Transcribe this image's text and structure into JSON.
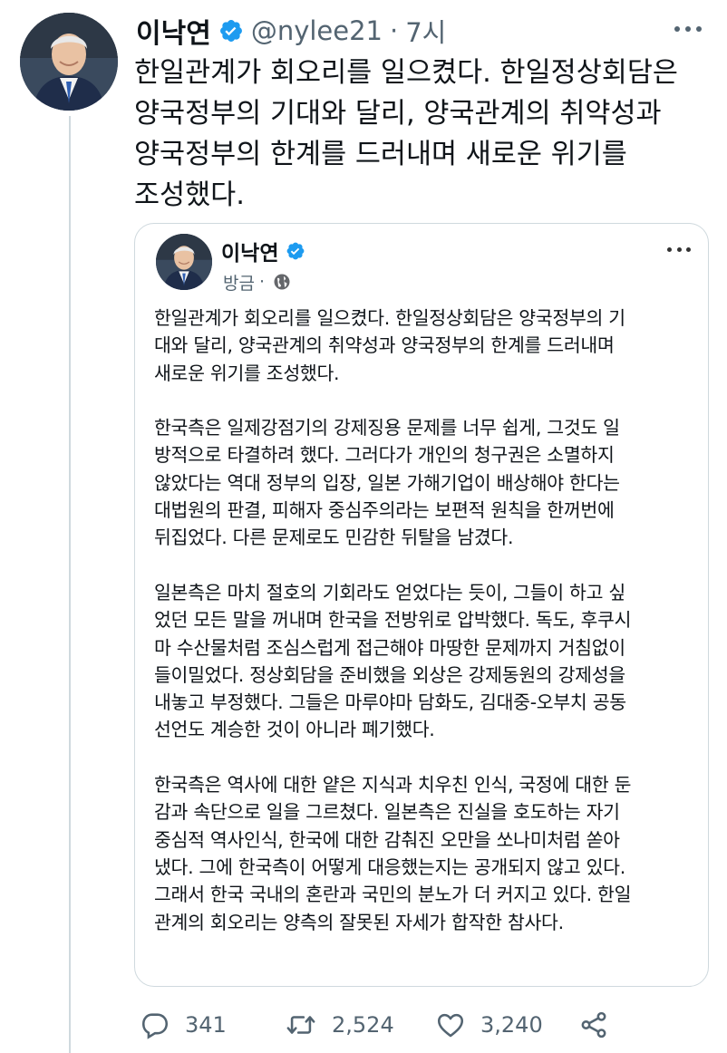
{
  "tweet": {
    "author_name": "이낙연",
    "handle": "@nylee21",
    "separator": "·",
    "time": "7시",
    "text": "한일관계가 회오리를 일으켰다. 한일정상회담은\n양국정부의 기대와 달리, 양국관계의 취약성과\n양국정부의 한계를 드러내며 새로운 위기를\n조성했다."
  },
  "quote": {
    "author_name": "이낙연",
    "time": "방금",
    "separator": "·",
    "body": "한일관계가 회오리를 일으켰다. 한일정상회담은 양국정부의 기\n대와 달리, 양국관계의 취약성과 양국정부의 한계를 드러내며\n새로운 위기를 조성했다.\n\n한국측은 일제강점기의 강제징용 문제를 너무 쉽게, 그것도 일\n방적으로 타결하려 했다. 그러다가 개인의 청구권은 소멸하지\n않았다는 역대 정부의 입장, 일본 가해기업이 배상해야 한다는\n대법원의 판결, 피해자 중심주의라는 보편적 원칙을 한꺼번에\n뒤집었다. 다른 문제로도 민감한 뒤탈을 남겼다.\n\n일본측은 마치 절호의 기회라도 얻었다는 듯이, 그들이 하고 싶\n었던 모든 말을 꺼내며 한국을 전방위로 압박했다. 독도, 후쿠시\n마 수산물처럼 조심스럽게 접근해야 마땅한 문제까지 거침없이\n들이밀었다. 정상회담을 준비했을 외상은 강제동원의 강제성을\n내놓고 부정했다. 그들은 마루야마 담화도, 김대중-오부치 공동\n선언도 계승한 것이 아니라 폐기했다.\n\n한국측은 역사에 대한 얕은 지식과 치우친 인식, 국정에 대한 둔\n감과 속단으로 일을 그르쳤다. 일본측은 진실을 호도하는 자기\n중심적 역사인식, 한국에 대한 감춰진 오만을 쏘나미처럼 쏟아\n냈다. 그에 한국측이 어떻게 대응했는지는 공개되지 않고 있다.\n그래서 한국 국내의 혼란과 국민의 분노가 더 커지고 있다. 한일\n관계의 회오리는 양측의 잘못된 자세가 합작한 참사다."
  },
  "actions": {
    "replies": "341",
    "retweets": "2,524",
    "likes": "3,240"
  },
  "icons": {
    "verified": "verified-badge-icon",
    "globe": "globe-icon",
    "reply": "reply-icon",
    "retweet": "retweet-icon",
    "like": "heart-icon",
    "share": "share-icon",
    "more": "more-icon"
  },
  "colors": {
    "verified": "#1d9bf0",
    "secondary_text": "#536471",
    "border": "#cfd9de"
  }
}
